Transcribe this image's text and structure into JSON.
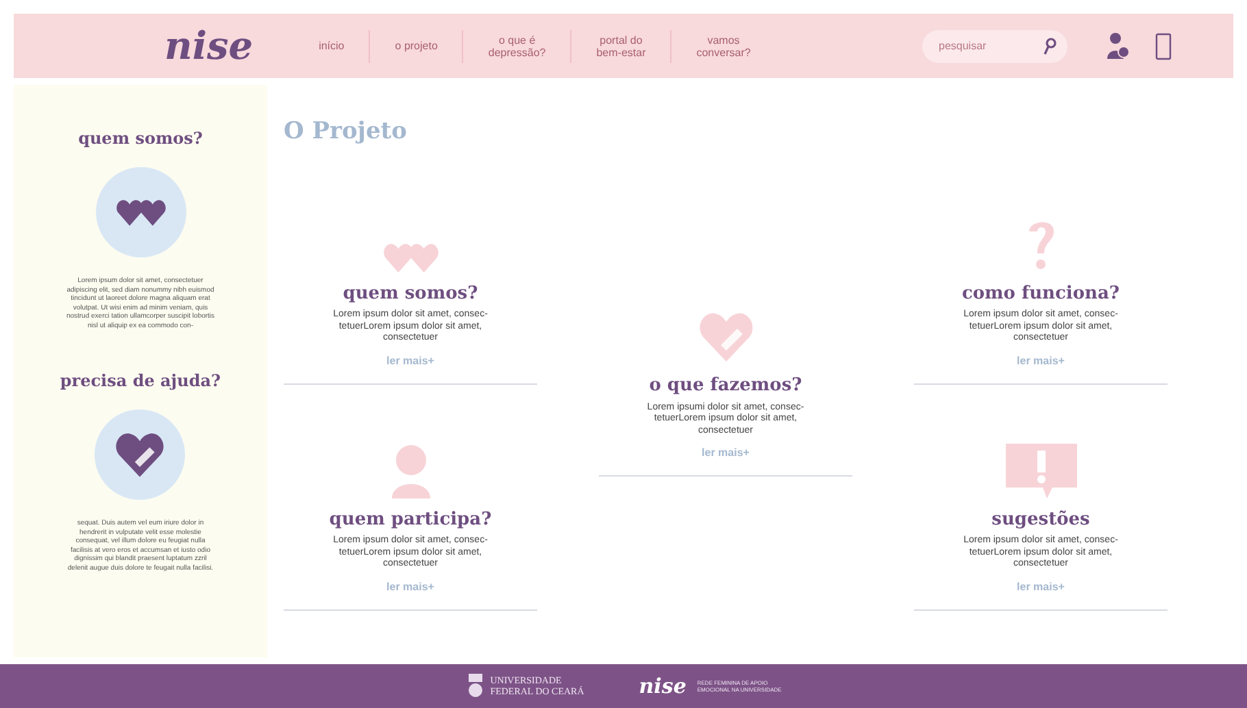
{
  "header": {
    "logo": "nise",
    "nav": [
      {
        "label": "início",
        "selected": false
      },
      {
        "label": "o projeto",
        "selected": false
      },
      {
        "label": "o que é\ndepressão?",
        "selected": false
      },
      {
        "label": "portal do\nbem-estar",
        "selected": false
      },
      {
        "label": "vamos\nconversar?",
        "selected": false
      }
    ],
    "search": {
      "placeholder": "pesquisar"
    }
  },
  "sidebar": [
    {
      "title": "quem somos?",
      "kind": "hearts",
      "text": "Lorem ipsum dolor sit amet, consectetuer adipiscing elit, sed diam nonummy nibh euismod tincidunt ut laoreet dolore magna aliquam erat volutpat. Ut wisi enim ad minim veniam, quis nostrud exerci tation ullamcorper suscipit lobortis nisl ut aliquip ex ea commodo con-"
    },
    {
      "title": "precisa de ajuda?",
      "kind": "bandage",
      "text": "sequat. Duis autem vel eum iriure dolor in hendrerit in vulputate velit esse molestie consequat, vel illum dolore eu feugiat nulla facilisis at vero eros et accumsan et iusto odio dignissim qui blandit praesent luptatum zzril delenit augue duis dolore te feugait nulla facilisi."
    }
  ],
  "page_title": "O Projeto",
  "columns": [
    [
      {
        "kind": "hearts",
        "title": "quem somos?",
        "text": "Lorem ipsum dolor sit amet, consec-\ntetuerLorem ipsum dolor sit amet,\nconsectetuer",
        "link": "ler mais+"
      },
      {
        "kind": "person",
        "title": "quem participa?",
        "text": "Lorem ipsum dolor sit amet, consec-\ntetuerLorem ipsum dolor sit amet,\nconsectetuer",
        "link": "ler mais+"
      }
    ],
    [
      {
        "kind": "bandage",
        "title": "o que fazemos?",
        "text": "Lorem ipsumi dolor sit amet, consec-\ntetuerLorem ipsum dolor sit amet,\nconsectetuer",
        "link": "ler mais+"
      }
    ],
    [
      {
        "kind": "question",
        "title": "como funciona?",
        "text": "Lorem ipsum dolor sit amet, consec-\ntetuerLorem ipsum dolor sit amet,\nconsectetuer",
        "link": "ler mais+"
      },
      {
        "kind": "alert",
        "title": "sugestões",
        "text": "Lorem ipsum dolor sit amet, consec-\ntetuerLorem ipsum dolor sit amet,\nconsectetuer",
        "link": "ler mais+"
      }
    ]
  ],
  "footer": {
    "university": "UNIVERSIDADE\nFEDERAL DO CEARÁ",
    "logo": "nise",
    "tagline": "REDE FEMININA DE APOIO\nEMOCIONAL NA UNIVERSIDADE"
  }
}
